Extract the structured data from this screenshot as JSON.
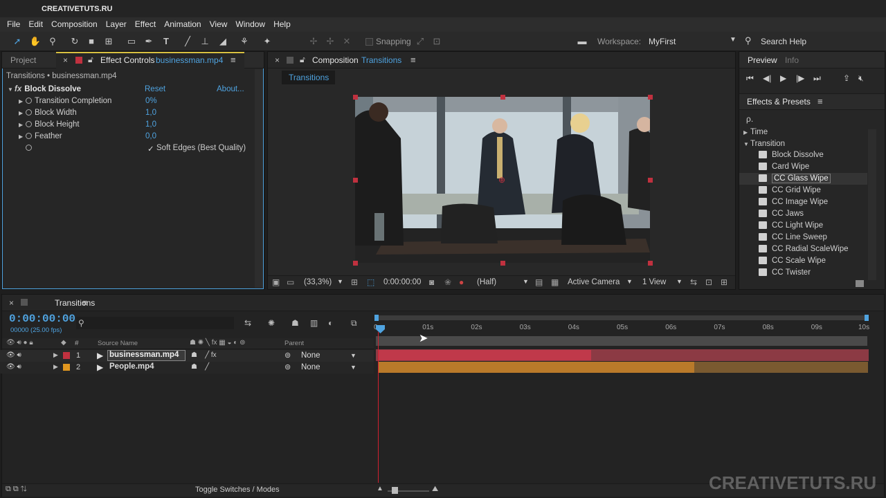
{
  "app": {
    "title": "CREATIVETUTS.RU"
  },
  "menu": [
    "File",
    "Edit",
    "Composition",
    "Layer",
    "Effect",
    "Animation",
    "View",
    "Window",
    "Help"
  ],
  "toolbar": {
    "snapping_label": "Snapping",
    "workspace_label": "Workspace:",
    "workspace_value": "MyFirst",
    "search_placeholder": "Search Help"
  },
  "left_panel": {
    "tab_project": "Project",
    "tab_effect_controls": "Effect Controls",
    "tab_effect_controls_file": "businessman.mp4",
    "breadcrumb": "Transitions • businessman.mp4",
    "effect_name": "Block Dissolve",
    "reset": "Reset",
    "about": "About...",
    "params": [
      {
        "label": "Transition Completion",
        "value": "0%"
      },
      {
        "label": "Block Width",
        "value": "1,0"
      },
      {
        "label": "Block Height",
        "value": "1,0"
      },
      {
        "label": "Feather",
        "value": "0,0"
      }
    ],
    "soft_edges": "Soft Edges (Best Quality)",
    "soft_edges_check": "✓"
  },
  "composition": {
    "tab_label": "Composition",
    "tab_name": "Transitions",
    "subtab": "Transitions",
    "zoom": "(33,3%)",
    "timecode": "0:00:00:00",
    "resolution": "(Half)",
    "camera": "Active Camera",
    "view": "1 View"
  },
  "right_panel": {
    "tab_preview": "Preview",
    "tab_info": "Info",
    "effects_title": "Effects & Presets",
    "search_icon_label": "ρ.",
    "categories": [
      {
        "label": "Time",
        "expanded": false
      },
      {
        "label": "Transition",
        "expanded": true
      }
    ],
    "items": [
      "Block Dissolve",
      "Card Wipe",
      "CC Glass Wipe",
      "CC Grid Wipe",
      "CC Image Wipe",
      "CC Jaws",
      "CC Light Wipe",
      "CC Line Sweep",
      "CC Radial ScaleWipe",
      "CC Scale Wipe",
      "CC Twister"
    ],
    "selected_item": "CC Glass Wipe"
  },
  "timeline": {
    "tab_name": "Transitions",
    "timecode": "0:00:00:00",
    "timecode_sub": "00000 (25.00 fps)",
    "search_icon_label": "ρ.",
    "col_source": "Source Name",
    "col_parent": "Parent",
    "col_hash": "#",
    "ruler": [
      "0s",
      "01s",
      "02s",
      "03s",
      "04s",
      "05s",
      "06s",
      "07s",
      "08s",
      "09s",
      "10s"
    ],
    "layers": [
      {
        "index": "1",
        "name": "businessman.mp4",
        "parent": "None",
        "color": "#c0313f",
        "bar_color": "#a0313c",
        "bar_dim": "#8c3a44"
      },
      {
        "index": "2",
        "name": "People.mp4",
        "parent": "None",
        "color": "#e0961f",
        "bar_color": "#b97a2a",
        "bar_dim": "#7a5a30"
      }
    ],
    "toggle_label": "Toggle Switches / Modes"
  },
  "watermark": "CREATIVETUTS.RU"
}
